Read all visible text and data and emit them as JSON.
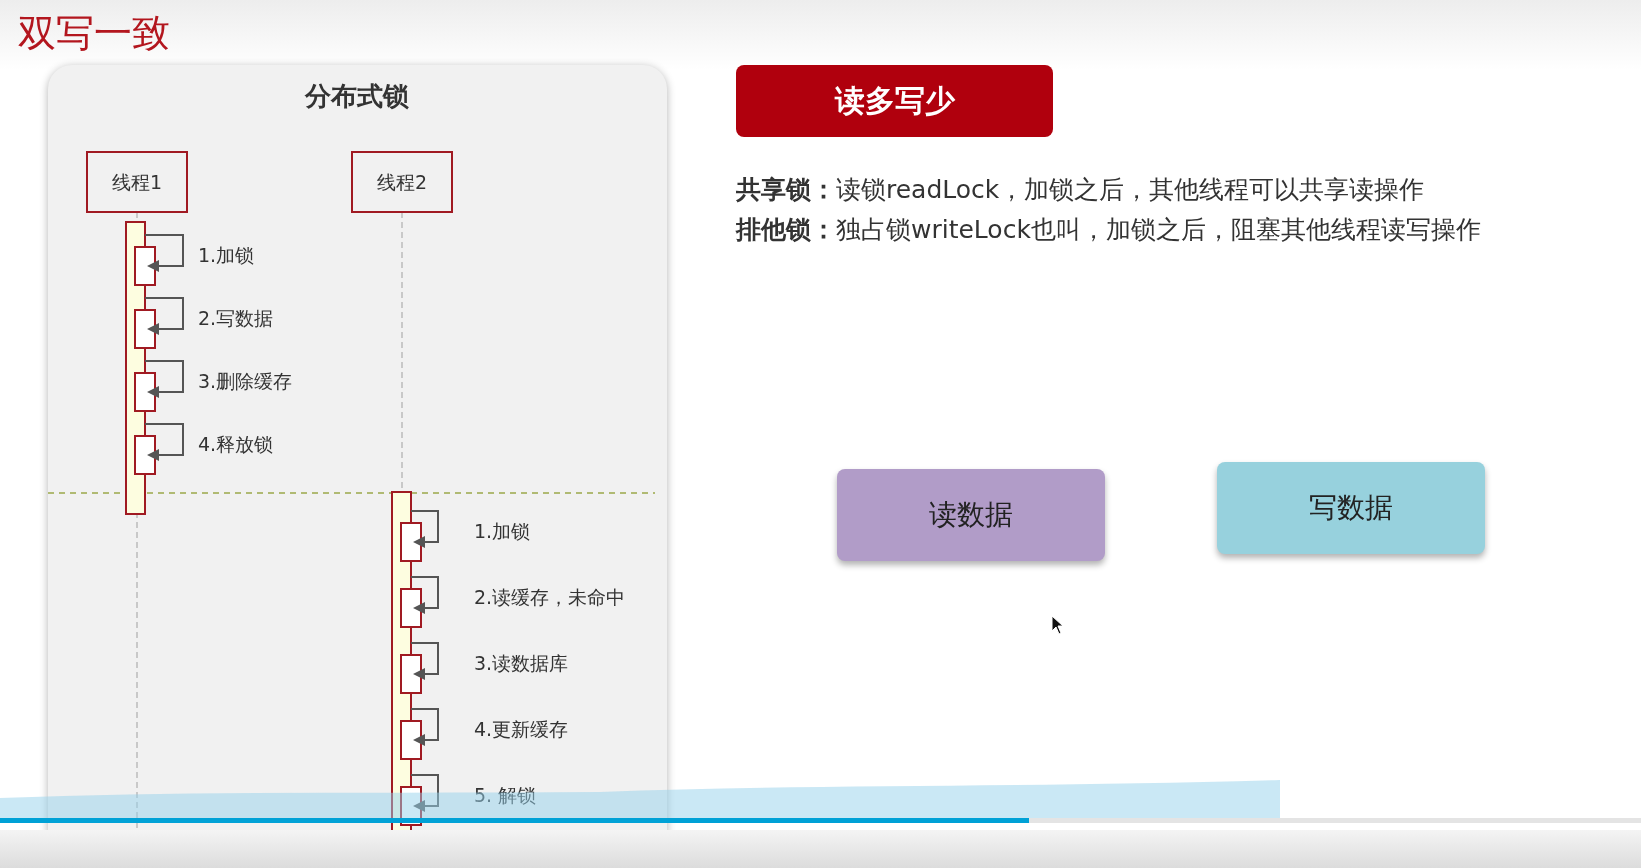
{
  "slide_title": "双写一致",
  "diagram": {
    "title": "分布式锁",
    "threads": [
      {
        "label": "线程1",
        "steps": [
          "1.加锁",
          "2.写数据",
          "3.删除缓存",
          "4.释放锁"
        ]
      },
      {
        "label": "线程2",
        "steps": [
          "1.加锁",
          "2.读缓存，未命中",
          "3.读数据库",
          "4.更新缓存",
          "5. 解锁"
        ]
      }
    ]
  },
  "badge": "读多写少",
  "definitions": [
    "**共享锁：**读锁readLock，加锁之后，其他线程可以共享读操作",
    "**排他锁：**独占锁writeLock也叫，加锁之后，阻塞其他线程读写操作"
  ],
  "boxes": [
    {
      "label": "读数据",
      "color": "#b19cc8"
    },
    {
      "label": "写数据",
      "color": "#97d1dd"
    }
  ],
  "player": {
    "progress": {
      "level": 0.627
    }
  }
}
